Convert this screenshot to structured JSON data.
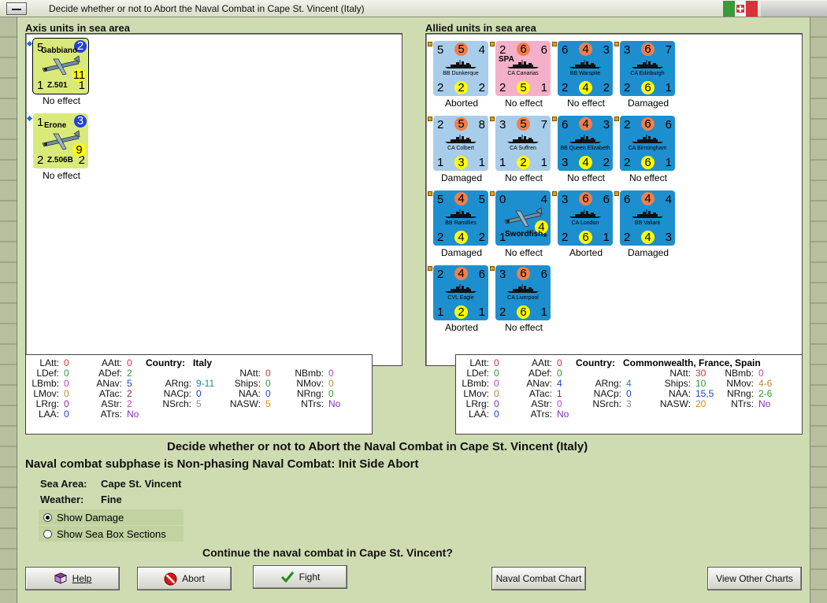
{
  "window": {
    "title": "Decide whether or not to Abort the Naval Combat in Cape St. Vincent (Italy)"
  },
  "colors": {
    "light_blue": "#a7cdea",
    "dark_blue": "#1d8fcf",
    "pink": "#f4b0c8",
    "green": "#d9ea7b",
    "orange": "#f07e4c",
    "yellow": "#ffff00",
    "navy": "#1f3fe0"
  },
  "axis": {
    "header": "Axis units in sea area",
    "units": [
      {
        "name": "Gabbiano",
        "type": "Z.501",
        "tl": "5",
        "tr": "2",
        "bl": "1",
        "br": "1",
        "bc": "11",
        "status": "No effect"
      },
      {
        "name": "Erone",
        "type": "Z.506B",
        "tl": "1",
        "tr": "3",
        "bl": "2",
        "br": "2",
        "bc": "9",
        "status": "No effect"
      }
    ],
    "stats": {
      "country_label": "Country:",
      "country": "Italy",
      "LAtt": "0",
      "LDef": "0",
      "LBmb": "0",
      "LMov": "0",
      "LRrg": "0",
      "LAA": "0",
      "AAtt": "0",
      "ADef": "2",
      "ANav": "5",
      "ATac": "2",
      "AStr": "2",
      "ATrs": "No",
      "ARng": "9-11",
      "NACp": "0",
      "NSrch": "5",
      "NAtt": "0",
      "Ships": "0",
      "NAA": "0",
      "NASW": "5",
      "NBmb": "0",
      "NMov": "0",
      "NRng": "0",
      "NTrs": "No"
    }
  },
  "allied": {
    "header": "Allied units in sea area",
    "units": [
      {
        "name": "BB Dunkerque",
        "tl": "5",
        "tc": "5",
        "tr": "4",
        "bl": "2",
        "bc": "2",
        "br": "2",
        "status": "Aborted",
        "color": "light"
      },
      {
        "name": "CA Canarias",
        "extra": "SPA",
        "tl": "2",
        "tc": "6",
        "tr": "6",
        "bl": "2",
        "bc": "5",
        "br": "1",
        "status": "No effect",
        "color": "pink"
      },
      {
        "name": "BB Warspite",
        "tl": "6",
        "tc": "4",
        "tr": "3",
        "bl": "2",
        "bc": "4",
        "br": "2",
        "status": "No effect",
        "color": "dark"
      },
      {
        "name": "CA Edinburgh",
        "tl": "3",
        "tc": "6",
        "tr": "7",
        "bl": "2",
        "bc": "6",
        "br": "1",
        "status": "Damaged",
        "color": "dark"
      },
      {
        "name": "CA Colbert",
        "tl": "2",
        "tc": "5",
        "tr": "8",
        "bl": "1",
        "bc": "3",
        "br": "1",
        "status": "Damaged",
        "color": "light"
      },
      {
        "name": "CA Suffren",
        "tl": "3",
        "tc": "5",
        "tr": "7",
        "bl": "1",
        "bc": "2",
        "br": "1",
        "status": "No effect",
        "color": "light"
      },
      {
        "name": "BB Queen Elizabeth",
        "tl": "6",
        "tc": "4",
        "tr": "3",
        "bl": "3",
        "bc": "4",
        "br": "2",
        "status": "No effect",
        "color": "dark"
      },
      {
        "name": "CA Birmingham",
        "tl": "2",
        "tc": "6",
        "tr": "6",
        "bl": "2",
        "bc": "6",
        "br": "1",
        "status": "No effect",
        "color": "dark"
      },
      {
        "name": "BB Ramillies",
        "tl": "5",
        "tc": "4",
        "tr": "5",
        "bl": "2",
        "bc": "4",
        "br": "2",
        "status": "Damaged",
        "color": "dark"
      },
      {
        "name": "Swordfish",
        "tl": "0",
        "tr": "4",
        "bl": "1",
        "bc": "4",
        "br": "*",
        "status": "No effect",
        "color": "dark",
        "air": true
      },
      {
        "name": "CA London",
        "tl": "3",
        "tc": "6",
        "tr": "6",
        "bl": "2",
        "bc": "6",
        "br": "1",
        "status": "Aborted",
        "color": "dark"
      },
      {
        "name": "BB Valiant",
        "tl": "6",
        "tc": "4",
        "tr": "4",
        "bl": "2",
        "bc": "4",
        "br": "3",
        "status": "Damaged",
        "color": "dark"
      },
      {
        "name": "CVL Eagle",
        "tl": "2",
        "tc": "4",
        "tr": "6",
        "bl": "1",
        "bc": "2",
        "br": "1",
        "status": "Aborted",
        "color": "dark"
      },
      {
        "name": "CA Liverpool",
        "tl": "3",
        "tc": "6",
        "tr": "6",
        "bl": "2",
        "bc": "6",
        "br": "1",
        "status": "No effect",
        "color": "dark"
      }
    ],
    "stats": {
      "country_label": "Country:",
      "country": "Commonwealth, France, Spain",
      "LAtt": "0",
      "LDef": "0",
      "LBmb": "0",
      "LMov": "0",
      "LRrg": "0",
      "LAA": "0",
      "AAtt": "0",
      "ADef": "0",
      "ANav": "4",
      "ATac": "1",
      "AStr": "0",
      "ATrs": "No",
      "ARng": "4",
      "NACp": "0",
      "NSrch": "3",
      "NAtt": "30",
      "Ships": "10",
      "NAA": "15,5",
      "NASW": "20",
      "NBmb": "0",
      "NMov": "4-6",
      "NRng": "2-6",
      "NTrs": "No"
    }
  },
  "info": {
    "heading": "Decide whether or not to Abort the Naval Combat in Cape St. Vincent (Italy)",
    "subphase": "Naval combat subphase is Non-phasing Naval Combat: Init Side Abort",
    "sea_area_label": "Sea Area:",
    "sea_area": "Cape St. Vincent",
    "weather_label": "Weather:",
    "weather": "Fine",
    "show_damage": "Show Damage",
    "show_sea_box": "Show Sea Box Sections",
    "question": "Continue the naval combat in Cape St. Vincent?"
  },
  "buttons": {
    "help": "Help",
    "abort": "Abort",
    "fight": "Fight",
    "naval_chart": "Naval Combat Chart",
    "other_charts": "View Other Charts"
  }
}
